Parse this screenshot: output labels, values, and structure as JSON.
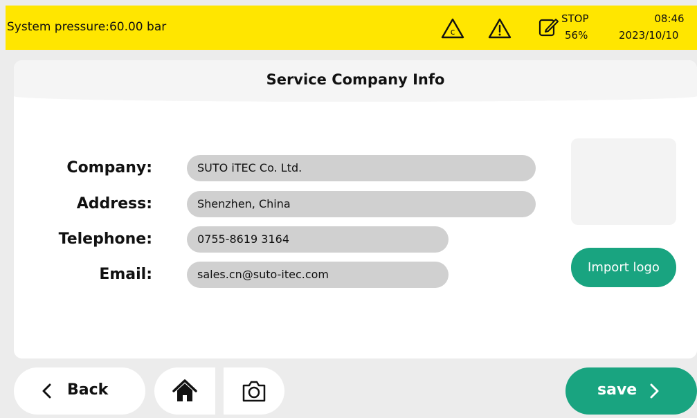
{
  "status_bar": {
    "pressure_text": "System pressure:60.00 bar",
    "icons": [
      "calibration-warning-icon",
      "warning-icon",
      "edit-icon"
    ],
    "stop_label": "STOP",
    "stop_percent": "56%",
    "time": "08:46",
    "date": "2023/10/10"
  },
  "page": {
    "title": "Service Company Info",
    "fields": [
      {
        "label": "Company:",
        "value": "SUTO iTEC Co. Ltd."
      },
      {
        "label": "Address:",
        "value": "Shenzhen, China"
      },
      {
        "label": "Telephone:",
        "value": "0755-8619 3164"
      },
      {
        "label": "Email:",
        "value": "sales.cn@suto-itec.com"
      }
    ],
    "import_logo_label": "Import logo"
  },
  "footer": {
    "back_label": "Back",
    "save_label": "save",
    "icons": [
      "home-icon",
      "camera-icon"
    ]
  },
  "colors": {
    "status_bar": "#ffe600",
    "accent": "#19a480",
    "field_bg": "#d0d0d0",
    "background": "#ececec"
  }
}
